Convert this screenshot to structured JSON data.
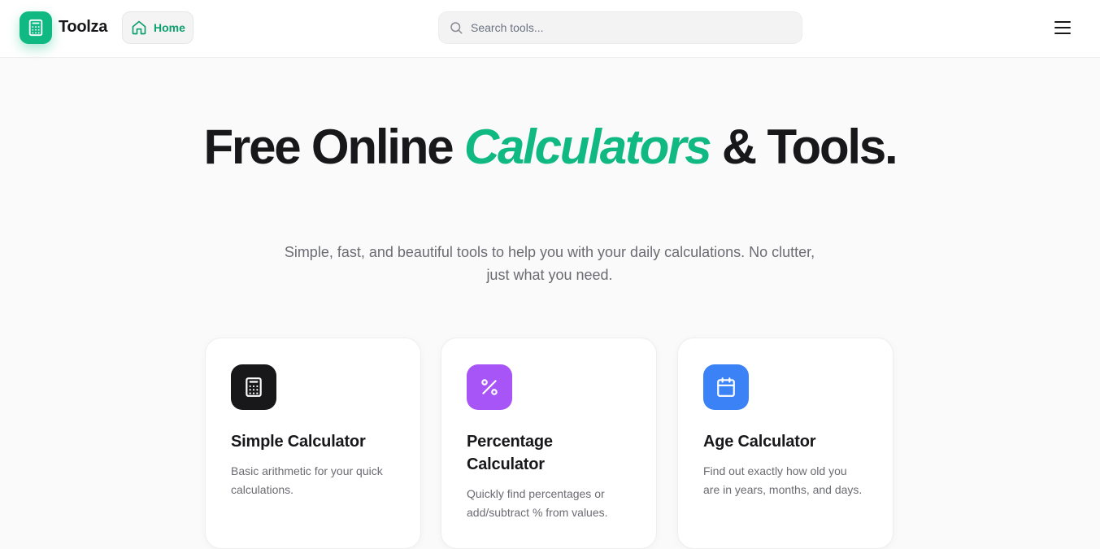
{
  "header": {
    "brand": "Toolza",
    "home_label": "Home",
    "search_placeholder": "Search tools..."
  },
  "hero": {
    "title_part1": "Free Online ",
    "title_accent": "Calculators",
    "title_part2": " & Tools.",
    "subtitle": "Simple, fast, and beautiful tools to help you with your daily calculations. No clutter, just what you need."
  },
  "tools": [
    {
      "title": "Simple Calculator",
      "description": "Basic arithmetic for your quick calculations.",
      "icon": "calculator-icon",
      "color": "#18181b"
    },
    {
      "title": "Percentage Calculator",
      "description": "Quickly find percentages or add/subtract % from values.",
      "icon": "percent-icon",
      "color": "#a855f7"
    },
    {
      "title": "Age Calculator",
      "description": "Find out exactly how old you are in years, months, and days.",
      "icon": "calendar-icon",
      "color": "#3b82f6"
    }
  ],
  "colors": {
    "accent": "#10b981",
    "home_text": "#0e9f6e"
  }
}
